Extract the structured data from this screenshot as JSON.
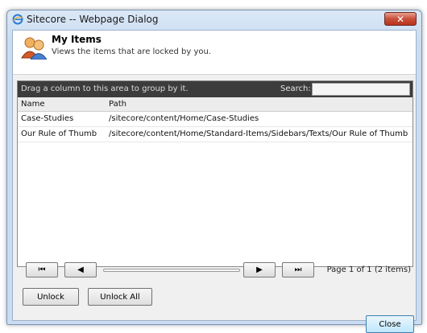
{
  "window": {
    "title": "Sitecore -- Webpage Dialog",
    "close_glyph": "✕"
  },
  "header": {
    "title": "My Items",
    "subtitle": "Views the items that are locked by you."
  },
  "grid": {
    "group_hint": "Drag a column to this area to group by it.",
    "search_label": "Search:",
    "search_value": "",
    "columns": {
      "name": "Name",
      "path": "Path"
    },
    "rows": [
      {
        "name": "Case-Studies",
        "path": "/sitecore/content/Home/Case-Studies"
      },
      {
        "name": "Our Rule of Thumb",
        "path": "/sitecore/content/Home/Standard-Items/Sidebars/Texts/Our Rule of Thumb"
      }
    ]
  },
  "pager": {
    "first_glyph": "⏮",
    "prev_glyph": "◀",
    "next_glyph": "▶",
    "last_glyph": "⏭",
    "page_info": "Page 1 of 1 (2 items)"
  },
  "actions": {
    "unlock": "Unlock",
    "unlock_all": "Unlock All",
    "close": "Close"
  },
  "colors": {
    "titlebar": "#c9dcf2",
    "group_bar": "#3c3c3c",
    "close_button": "#c9503a"
  }
}
